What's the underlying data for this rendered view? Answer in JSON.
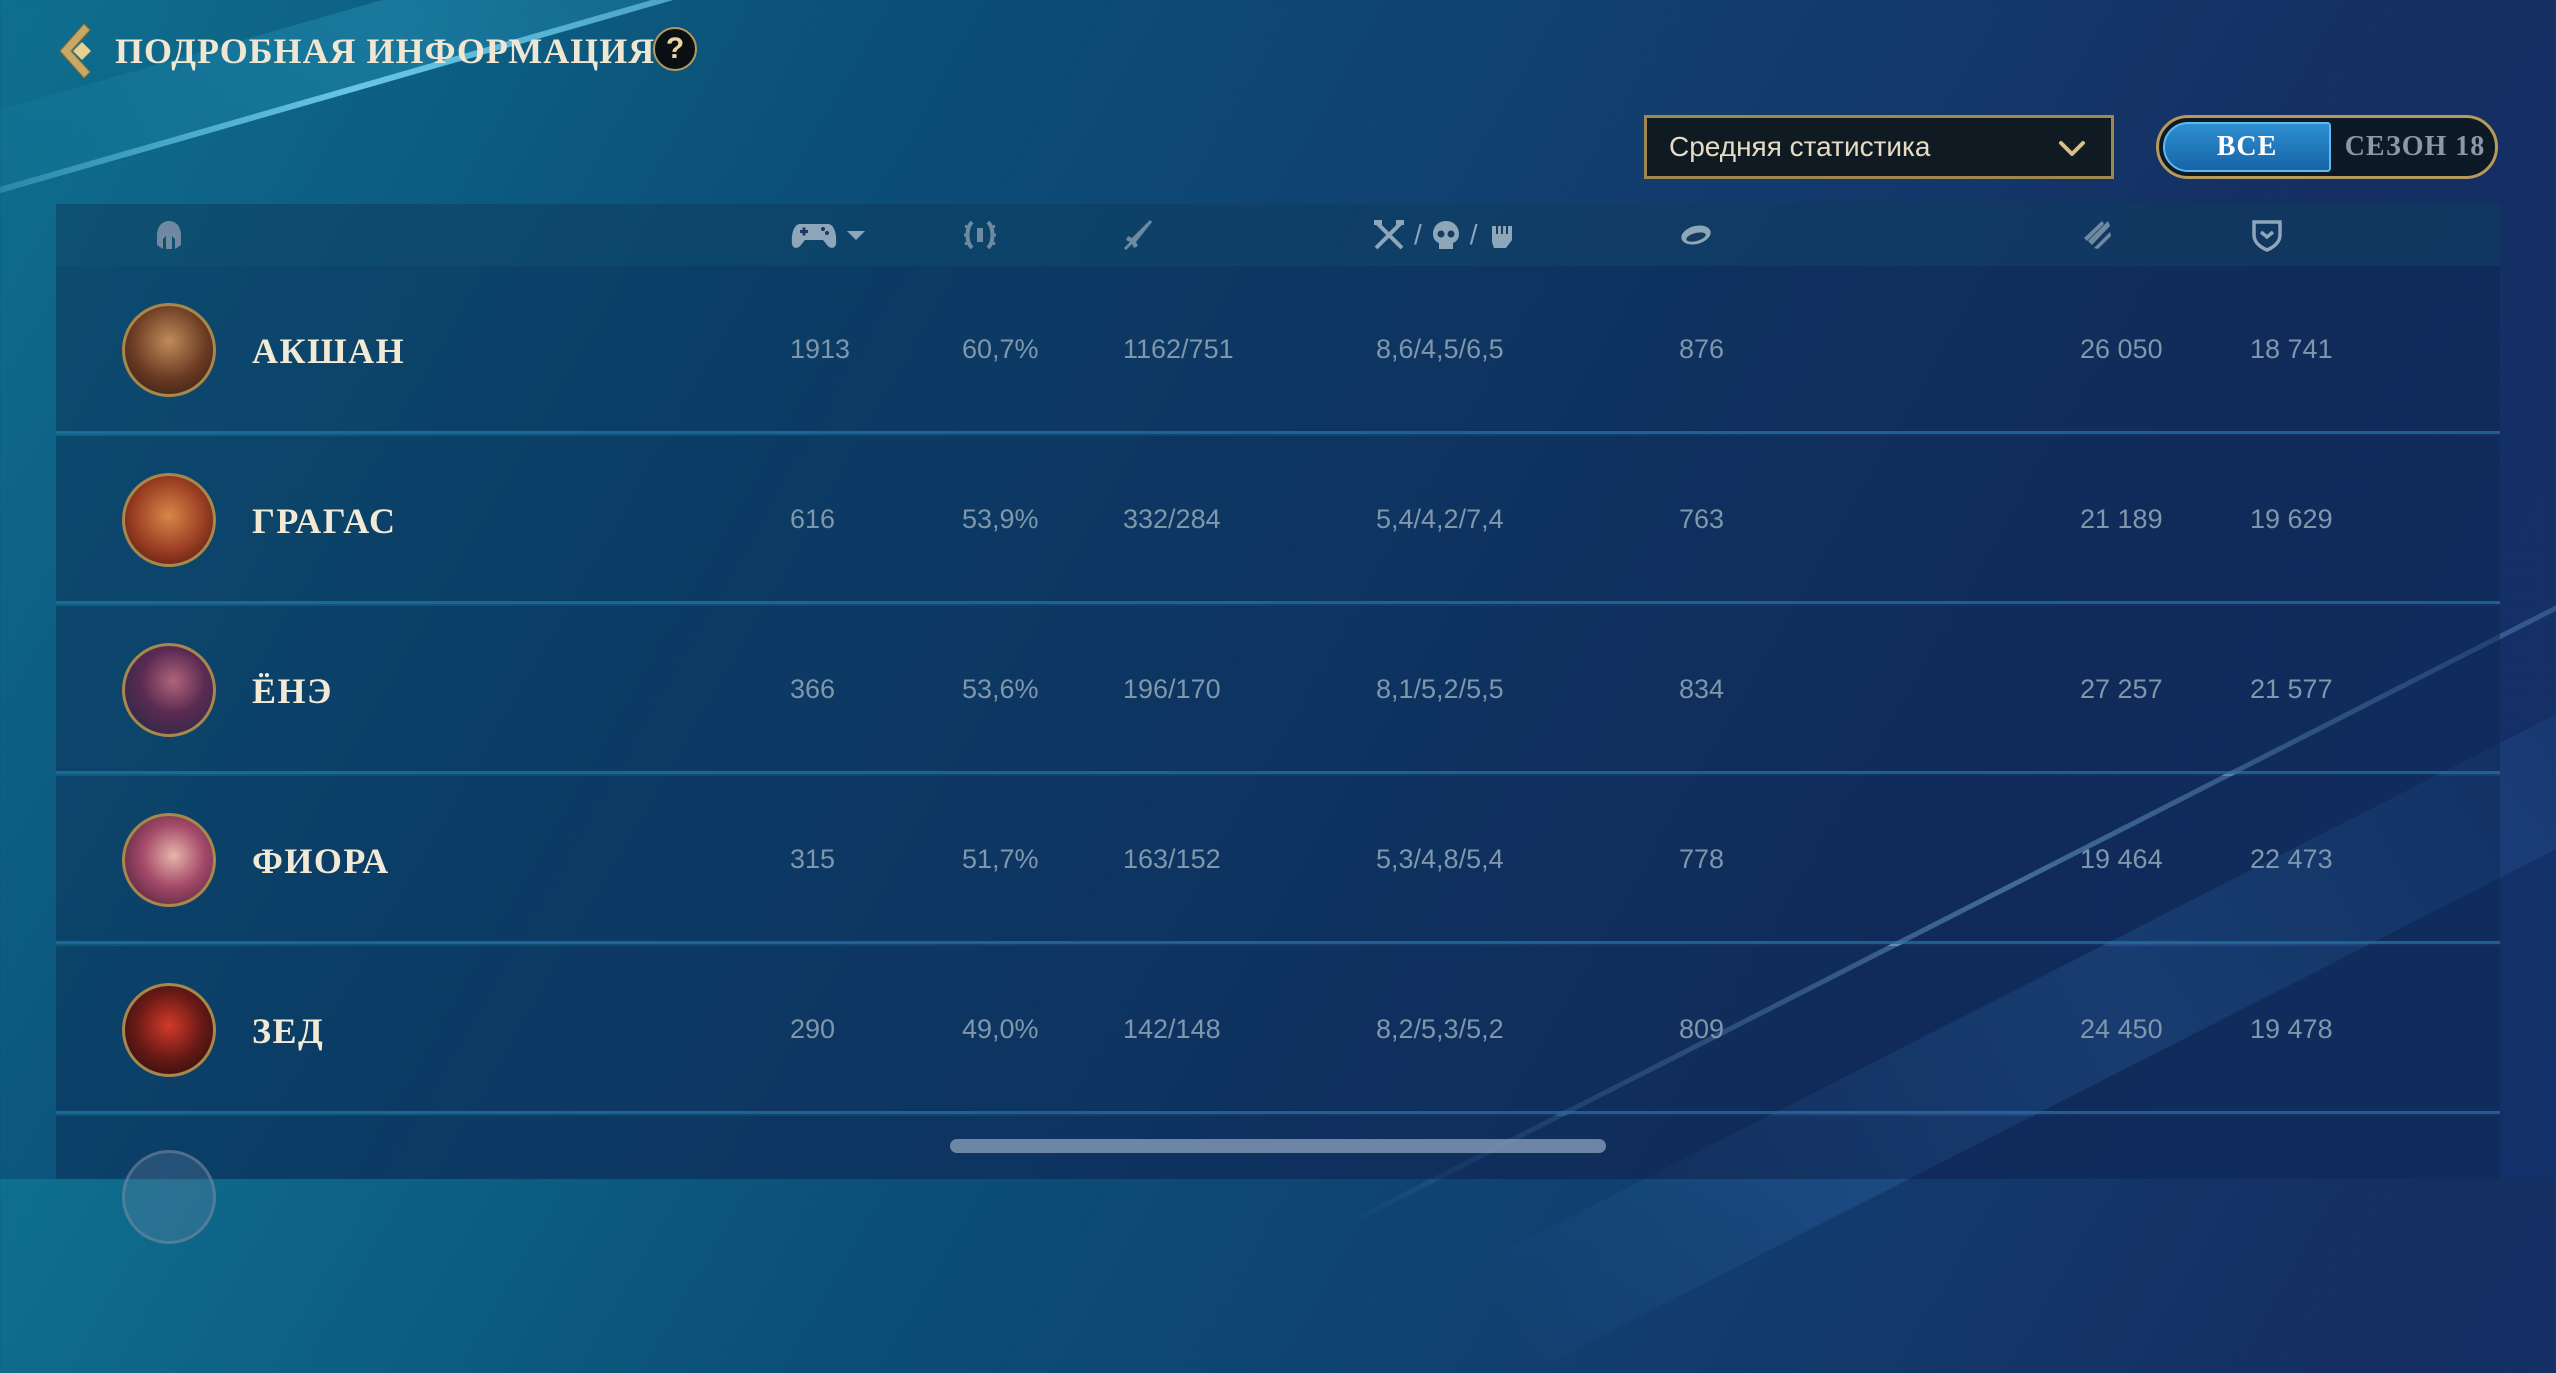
{
  "header": {
    "title": "ПОДРОБНАЯ ИНФОРМАЦИЯ",
    "help_label": "?"
  },
  "filters": {
    "stat_mode": "Средняя статистика",
    "toggle": {
      "all_label": "ВСЕ",
      "season_label": "СЕЗОН 18",
      "selected": "all"
    }
  },
  "columns": [
    {
      "key": "champion",
      "icon": "helmet-icon"
    },
    {
      "key": "games",
      "icon": "controller-icon",
      "sorted": "desc"
    },
    {
      "key": "winrate",
      "icon": "laurel-icon"
    },
    {
      "key": "wins_losses",
      "icon": "sword-icon"
    },
    {
      "key": "kda",
      "icons": [
        "crossed-swords-icon",
        "skull-icon",
        "fist-icon"
      ],
      "separator": "/"
    },
    {
      "key": "cs",
      "icon": "minion-icon"
    },
    {
      "key": "damage",
      "icon": "claw-icon"
    },
    {
      "key": "tank",
      "icon": "shield-icon"
    }
  ],
  "rows": [
    {
      "champion": "АКШАН",
      "games": "1913",
      "winrate": "60,7%",
      "wins_losses": "1162/751",
      "kda": "8,6/4,5/6,5",
      "cs": "876",
      "damage": "26 050",
      "tank": "18 741"
    },
    {
      "champion": "ГРАГАС",
      "games": "616",
      "winrate": "53,9%",
      "wins_losses": "332/284",
      "kda": "5,4/4,2/7,4",
      "cs": "763",
      "damage": "21 189",
      "tank": "19 629"
    },
    {
      "champion": "ЁНЭ",
      "games": "366",
      "winrate": "53,6%",
      "wins_losses": "196/170",
      "kda": "8,1/5,2/5,5",
      "cs": "834",
      "damage": "27 257",
      "tank": "21 577"
    },
    {
      "champion": "ФИОРА",
      "games": "315",
      "winrate": "51,7%",
      "wins_losses": "163/152",
      "kda": "5,3/4,8/5,4",
      "cs": "778",
      "damage": "19 464",
      "tank": "22 473"
    },
    {
      "champion": "ЗЕД",
      "games": "290",
      "winrate": "49,0%",
      "wins_losses": "142/148",
      "kda": "8,2/5,3/5,2",
      "cs": "809",
      "damage": "24 450",
      "tank": "19 478"
    }
  ],
  "colors": {
    "gold": "#b79a5c",
    "accent_blue": "#2d8fd0",
    "text_muted": "#7f97ab",
    "text_light": "#f3ead6"
  }
}
